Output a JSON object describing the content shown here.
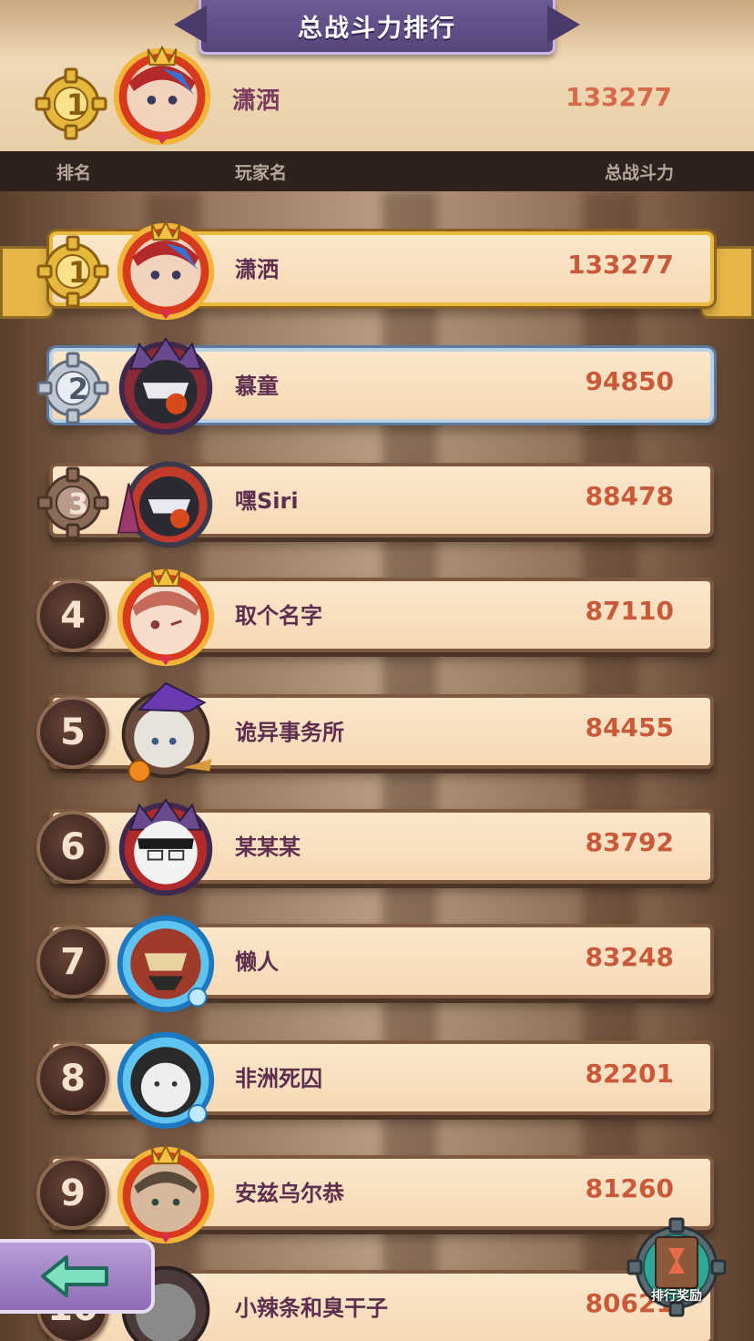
{
  "title": "总战斗力排行",
  "my_entry": {
    "rank": "1",
    "name": "潇洒",
    "power": "133277"
  },
  "header": {
    "rank": "排名",
    "player": "玩家名",
    "power": "总战斗力"
  },
  "rows": [
    {
      "rank": "1",
      "name": "潇洒",
      "power": "133277"
    },
    {
      "rank": "2",
      "name": "慕童",
      "power": "94850"
    },
    {
      "rank": "3",
      "name": "嘿Siri",
      "power": "88478"
    },
    {
      "rank": "4",
      "name": "取个名字",
      "power": "87110"
    },
    {
      "rank": "5",
      "name": "诡异事务所",
      "power": "84455"
    },
    {
      "rank": "6",
      "name": "某某某",
      "power": "83792"
    },
    {
      "rank": "7",
      "name": "懒人",
      "power": "83248"
    },
    {
      "rank": "8",
      "name": "非洲死囚",
      "power": "82201"
    },
    {
      "rank": "9",
      "name": "安兹乌尔恭",
      "power": "81260"
    },
    {
      "rank": "10",
      "name": "小辣条和臭干子",
      "power": "80621"
    }
  ],
  "buttons": {
    "back": "back-arrow-icon",
    "rank_reward": "排行奖励"
  }
}
